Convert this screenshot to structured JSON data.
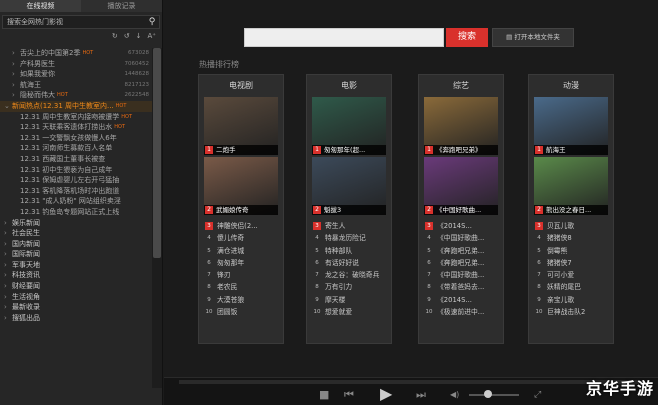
{
  "sidebar": {
    "tabs": [
      "在线视频",
      "播放记录"
    ],
    "search_placeholder": "搜索全网热门影视",
    "tool_icons": [
      "↻",
      "↺",
      "↓",
      "A⁺"
    ],
    "items": [
      {
        "text": "舌尖上的中国第2季",
        "hot": "HOT",
        "count": "673028",
        "arrow": "›",
        "kind": "sub"
      },
      {
        "text": "产科男医生",
        "hot": "",
        "count": "7060452",
        "arrow": "›",
        "kind": "sub"
      },
      {
        "text": "如果我爱你",
        "hot": "",
        "count": "1448628",
        "arrow": "›",
        "kind": "sub"
      },
      {
        "text": "航海王",
        "hot": "",
        "count": "8217123",
        "arrow": "›",
        "kind": "sub"
      },
      {
        "text": "隐秘而伟大",
        "hot": "HOT",
        "count": "2622548",
        "arrow": "›",
        "kind": "sub"
      },
      {
        "text": "新闻热点(12.31 周中生教室内...",
        "hot": "HOT",
        "count": "",
        "arrow": "⌄",
        "kind": "sel"
      },
      {
        "text": "12.31 周中生教室内接吻被遭学",
        "hot": "HOT",
        "count": "",
        "arrow": "",
        "kind": "sub"
      },
      {
        "text": "12.31 天联乘客遗体打捞出水",
        "hot": "HOT",
        "count": "",
        "arrow": "",
        "kind": "sub"
      },
      {
        "text": "12.31 一交警飘女孩做慢人6年",
        "hot": "",
        "count": "",
        "arrow": "",
        "kind": "sub"
      },
      {
        "text": "12.31 河南师生募款百人名单",
        "hot": "",
        "count": "",
        "arrow": "",
        "kind": "sub"
      },
      {
        "text": "12.31 西藏国土董事长被查",
        "hot": "",
        "count": "",
        "arrow": "",
        "kind": "sub"
      },
      {
        "text": "12.31 初中生猥亵为自己成年",
        "hot": "",
        "count": "",
        "arrow": "",
        "kind": "sub"
      },
      {
        "text": "12.31 保姆虐婴儿左右开弓猛抽",
        "hot": "",
        "count": "",
        "arrow": "",
        "kind": "sub"
      },
      {
        "text": "12.31 客机降落机场时冲出跑道",
        "hot": "",
        "count": "",
        "arrow": "",
        "kind": "sub"
      },
      {
        "text": "12.31 \"成人奶粉\" 网站组织卖淫",
        "hot": "",
        "count": "",
        "arrow": "",
        "kind": "sub"
      },
      {
        "text": "12.31 钓鱼岛专题网站正式上线",
        "hot": "",
        "count": "",
        "arrow": "",
        "kind": "sub"
      },
      {
        "text": "娱乐新闻",
        "hot": "",
        "count": "",
        "arrow": "›",
        "kind": "cat"
      },
      {
        "text": "社会民生",
        "hot": "",
        "count": "",
        "arrow": "›",
        "kind": "cat"
      },
      {
        "text": "国内新闻",
        "hot": "",
        "count": "",
        "arrow": "›",
        "kind": "cat"
      },
      {
        "text": "国际新闻",
        "hot": "",
        "count": "",
        "arrow": "›",
        "kind": "cat"
      },
      {
        "text": "军事天地",
        "hot": "",
        "count": "",
        "arrow": "›",
        "kind": "cat"
      },
      {
        "text": "科技资讯",
        "hot": "",
        "count": "",
        "arrow": "›",
        "kind": "cat"
      },
      {
        "text": "财经要闻",
        "hot": "",
        "count": "",
        "arrow": "›",
        "kind": "cat"
      },
      {
        "text": "生活视角",
        "hot": "",
        "count": "",
        "arrow": "›",
        "kind": "cat"
      },
      {
        "text": "最新收录",
        "hot": "",
        "count": "",
        "arrow": "›",
        "kind": "top"
      },
      {
        "text": "搜狐出品",
        "hot": "",
        "count": "",
        "arrow": "›",
        "kind": "top"
      }
    ]
  },
  "toolbar": {
    "search_button": "搜索",
    "open_folder_icon": "▤",
    "open_folder": "打开本地文件夹"
  },
  "rank_heading": "热播排行榜",
  "panels": [
    {
      "title": "电视剧",
      "posters": [
        {
          "num": "1",
          "caption": "二炮手",
          "color": "#5a4a3c"
        },
        {
          "num": "2",
          "caption": "武媚娘传奇",
          "color": "#7a5a48"
        }
      ],
      "items": [
        "神雕侠侣(2...",
        "傻儿传奇",
        "满仓进城",
        "匆匆那年",
        "锋刃",
        "老农民",
        "大漠苍狼",
        "团圆饭"
      ]
    },
    {
      "title": "电影",
      "posters": [
        {
          "num": "1",
          "caption": "匆匆那年(超...",
          "color": "#2f5a4a"
        },
        {
          "num": "2",
          "caption": "魁拔3",
          "color": "#3c4a5a"
        }
      ],
      "items": [
        "寄生人",
        "特暴龙历险记",
        "特种部队",
        "有话好好说",
        "龙之谷：破晓奇兵",
        "万有引力",
        "摩天楼",
        "想爱就爱"
      ]
    },
    {
      "title": "综艺",
      "posters": [
        {
          "num": "1",
          "caption": "《奔跑吧兄弟》",
          "color": "#8a6a3a"
        },
        {
          "num": "2",
          "caption": "《中国好歌曲...",
          "color": "#6a3a7a"
        }
      ],
      "items": [
        "《2014S...",
        "《中国好歌曲...",
        "《奔跑吧兄弟...",
        "《奔跑吧兄弟...",
        "《中国好歌曲...",
        "《带着爸妈去...",
        "《2014S...",
        "《极速前进中..."
      ]
    },
    {
      "title": "动漫",
      "posters": [
        {
          "num": "1",
          "caption": "航海王",
          "color": "#4a6a8a"
        },
        {
          "num": "2",
          "caption": "熊出没之春日...",
          "color": "#5a8a4a"
        }
      ],
      "items": [
        "贝瓦儿歌",
        "猪猪侠8",
        "倒霉熊",
        "猪猪侠7",
        "可可小爱",
        "妖精的尾巴",
        "亲宝儿歌",
        "巨神战击队2"
      ]
    }
  ],
  "controls": {
    "stop_icon": "■",
    "play_icon": "▶",
    "prev_icon": "⏮",
    "next_icon": "⏭",
    "volume_icon": "◀)",
    "fullscreen_icon": "⤢"
  },
  "watermark": "京华手游"
}
